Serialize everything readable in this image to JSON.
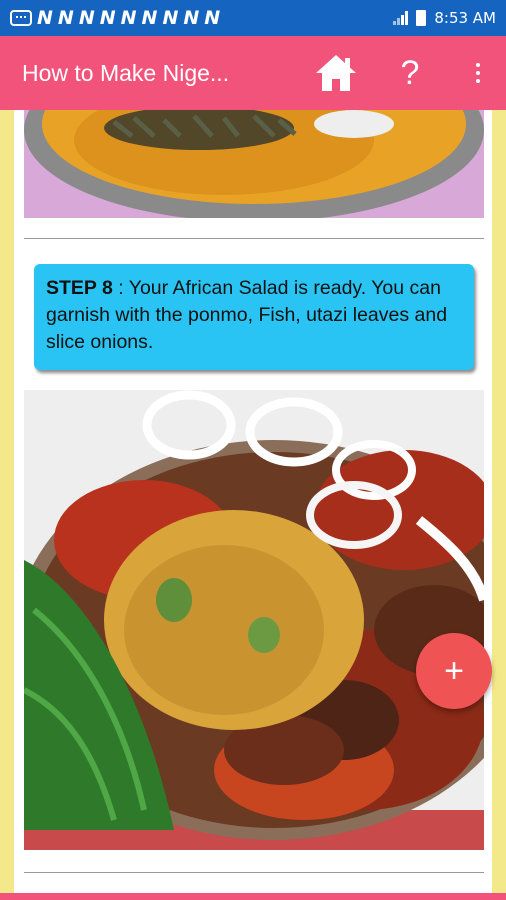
{
  "status_bar": {
    "notifications": [
      "N",
      "N",
      "N",
      "N",
      "N",
      "N",
      "N",
      "N",
      "N"
    ],
    "time": "8:53 AM",
    "icons": [
      "message-icon",
      "signal-icon",
      "battery-icon"
    ]
  },
  "app_bar": {
    "title": "How to Make Nige...",
    "home_icon": "home-icon",
    "help_label": "?",
    "menu_icon": "overflow-menu-icon",
    "color": "#f2537b"
  },
  "step": {
    "label": "STEP 8",
    "text": " : Your African Salad is ready. You can garnish with the ponmo, Fish, utazi leaves and slice onions.",
    "box_color": "#29c4f3"
  },
  "fab": {
    "label": "+",
    "color": "#f05353"
  },
  "images": {
    "previous_step_image": "bowl of palm oil paste with sliced ugba",
    "dish_image": "plate of african salad with onion rings, ponmo and utazi leaves"
  }
}
